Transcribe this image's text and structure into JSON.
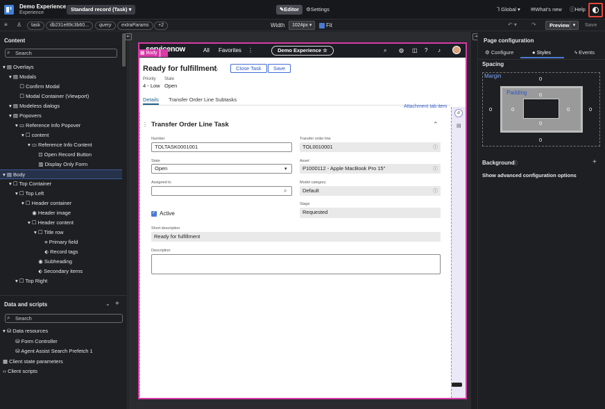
{
  "topbar": {
    "app_name": "Demo Experience",
    "app_sub": "Experience",
    "record_select": "Standard record (Task)",
    "editor_label": "Editor",
    "settings_label": "Settings",
    "global_label": "Global",
    "whats_new_label": "What's new",
    "help_label": "Help"
  },
  "toolbar": {
    "chips": [
      "task",
      "db231e89c3b60...",
      "query",
      "extraParams",
      "+2"
    ],
    "width_label": "Width",
    "width_value": "1024px",
    "fit_label": "Fit",
    "preview_label": "Preview",
    "save_label": "Save"
  },
  "content_panel": {
    "title": "Content",
    "search_placeholder": "Search",
    "tree": [
      {
        "label": "Overlays",
        "level": 0,
        "icon": "container"
      },
      {
        "label": "Modals",
        "level": 1,
        "icon": "container"
      },
      {
        "label": "Confirm Modal",
        "level": 2,
        "icon": "box"
      },
      {
        "label": "Modal Container (Viewport)",
        "level": 2,
        "icon": "box"
      },
      {
        "label": "Modeless dialogs",
        "level": 1,
        "icon": "container"
      },
      {
        "label": "Popovers",
        "level": 1,
        "icon": "container"
      },
      {
        "label": "Reference Info Popover",
        "level": 2,
        "icon": "popover"
      },
      {
        "label": "content",
        "level": 3,
        "icon": "box"
      },
      {
        "label": "Reference Info Content",
        "level": 4,
        "icon": "popover"
      },
      {
        "label": "Open Record Button",
        "level": 5,
        "icon": "button"
      },
      {
        "label": "Display Only Form",
        "level": 5,
        "icon": "form"
      },
      {
        "label": "Body",
        "level": 0,
        "icon": "container",
        "selected": true
      },
      {
        "label": "Top Container",
        "level": 1,
        "icon": "box"
      },
      {
        "label": "Top Left",
        "level": 2,
        "icon": "box"
      },
      {
        "label": "Header container",
        "level": 3,
        "icon": "box"
      },
      {
        "label": "Header image",
        "level": 4,
        "icon": "eye"
      },
      {
        "label": "Header content",
        "level": 4,
        "icon": "box"
      },
      {
        "label": "Title row",
        "level": 5,
        "icon": "box"
      },
      {
        "label": "Primary field",
        "level": 6,
        "icon": "text"
      },
      {
        "label": "Record tags",
        "level": 6,
        "icon": "tag"
      },
      {
        "label": "Subheading",
        "level": 5,
        "icon": "eye"
      },
      {
        "label": "Secondary items",
        "level": 5,
        "icon": "tag"
      },
      {
        "label": "Top Right",
        "level": 2,
        "icon": "box"
      }
    ]
  },
  "data_panel": {
    "title": "Data and scripts",
    "search_placeholder": "Search",
    "items": [
      {
        "label": "Data resources",
        "level": 0,
        "icon": "db"
      },
      {
        "label": "Form Controller",
        "level": 1,
        "icon": "db"
      },
      {
        "label": "Agent Assist Search Prefetch 1",
        "level": 1,
        "icon": "db"
      },
      {
        "label": "Client state parameters",
        "level": 0,
        "icon": "grid"
      },
      {
        "label": "Client scripts",
        "level": 0,
        "icon": "code"
      }
    ]
  },
  "canvas": {
    "body_tag": "Body",
    "sn_logo": "servicenow",
    "nav": [
      "All",
      "Favorites"
    ],
    "demo_pill": "Demo Experience",
    "record_title": "Ready for fulfillment",
    "close_task_label": "Close Task",
    "save_label": "Save",
    "priority_label": "Priority",
    "priority_value": "4 - Low",
    "state_label": "State",
    "state_value": "Open",
    "tabs": [
      "Details",
      "Transfer Order Line Subtasks"
    ],
    "attachment_link": "Attachment tab item",
    "section_title": "Transfer Order Line Task",
    "fields": {
      "number_label": "Number",
      "number_value": "TOLTASK0001001",
      "tol_label": "Transfer order line",
      "tol_value": "TOL0010001",
      "state_label": "State",
      "state_value": "Open",
      "asset_label": "Asset",
      "asset_value": "P1000112 - Apple MacBook Pro 15\"",
      "assigned_label": "Assigned to",
      "assigned_value": "",
      "model_label": "Model category",
      "model_value": "Default",
      "active_label": "Active",
      "stage_label": "Stage",
      "stage_value": "Requested",
      "short_desc_label": "Short description",
      "short_desc_value": "Ready for fulfillment",
      "desc_label": "Description",
      "desc_value": ""
    }
  },
  "right_panel": {
    "title": "Page configuration",
    "tabs": [
      "Configure",
      "Styles",
      "Events"
    ],
    "spacing_label": "Spacing",
    "margin_label": "Margin",
    "padding_label": "Padding",
    "margin": {
      "top": "0",
      "right": "0",
      "bottom": "0",
      "left": "0"
    },
    "padding": {
      "top": "0",
      "right": "0",
      "bottom": "0",
      "left": "0"
    },
    "background_label": "Background",
    "advanced_label": "Show advanced configuration options"
  },
  "colors": {
    "accent": "#4a7bd4",
    "body_outline": "#d93aa8",
    "highlight": "#e8473d"
  }
}
